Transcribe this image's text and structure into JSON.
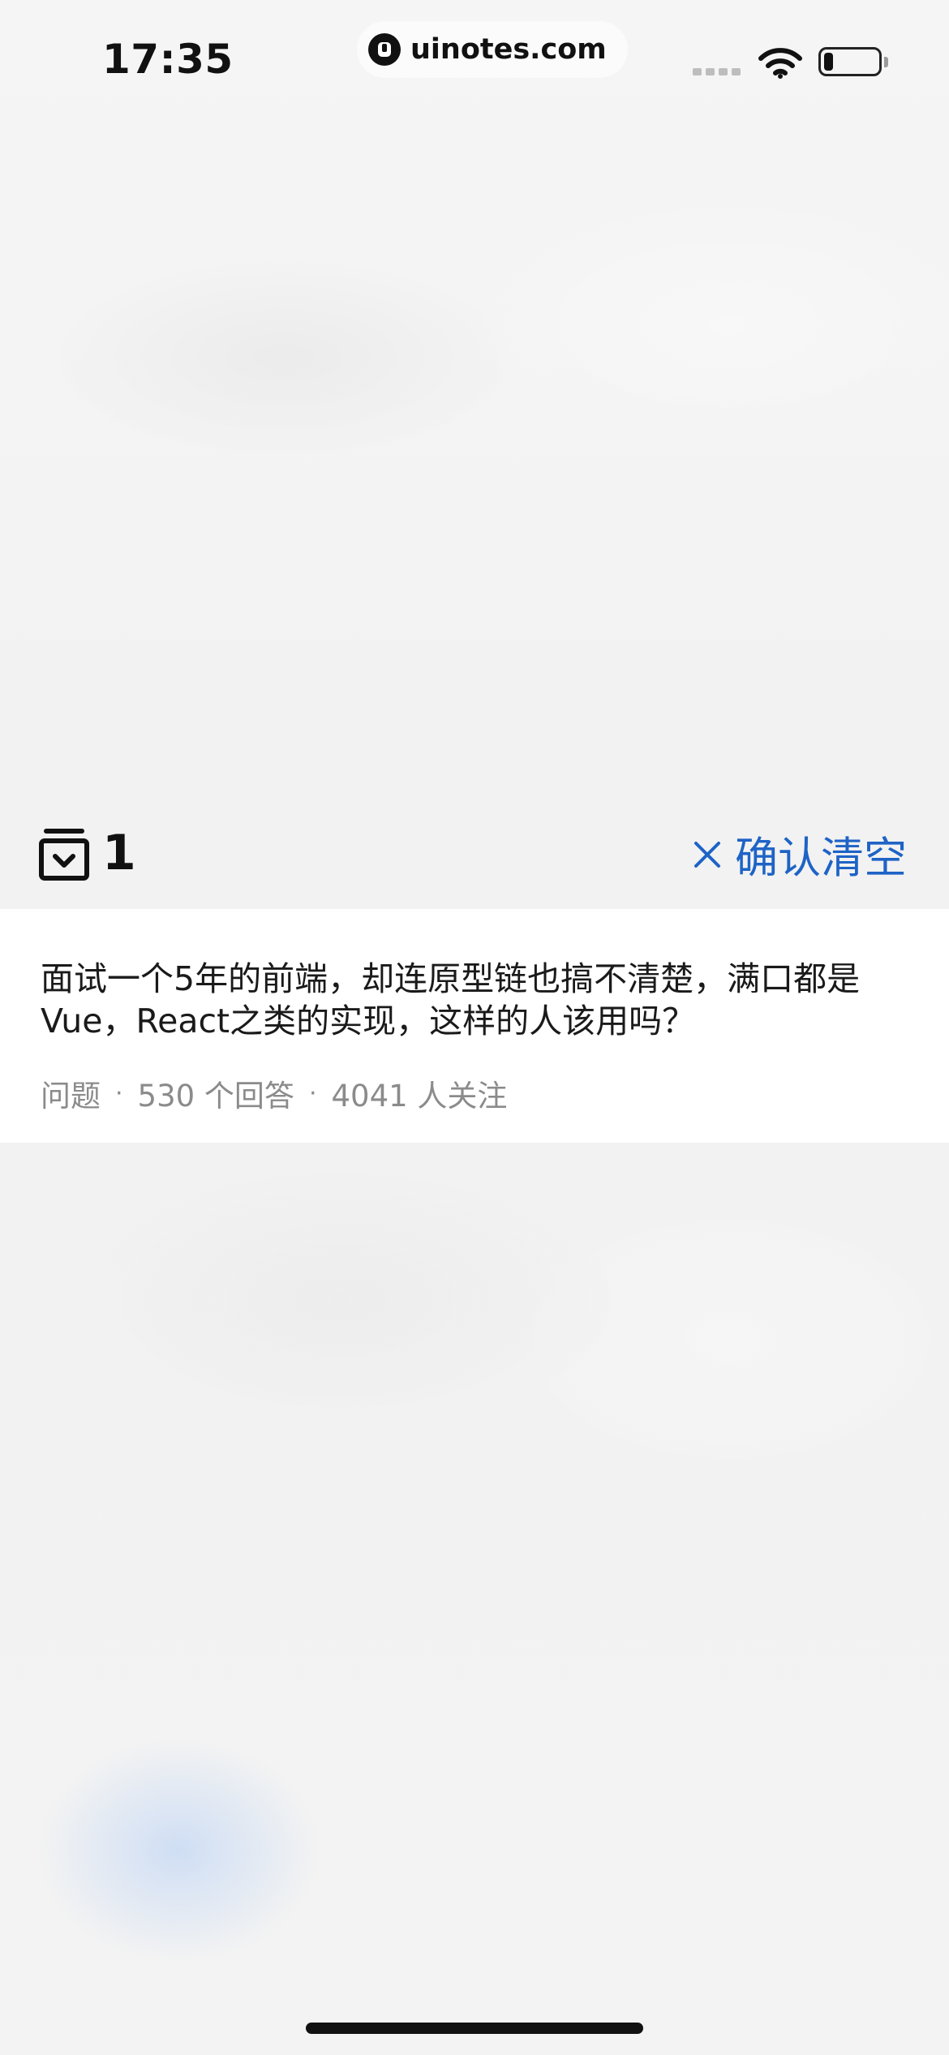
{
  "status_bar": {
    "time": "17:35",
    "url": "uinotes.com"
  },
  "clear_bar": {
    "count": "1",
    "confirm_label": "确认清空",
    "accent_color": "#1e63c6"
  },
  "item": {
    "title": "面试一个5年的前端，却连原型链也搞不清楚，满口都是Vue，React之类的实现，这样的人该用吗？",
    "type": "问题",
    "answers": "530 个回答",
    "followers": "4041 人关注"
  }
}
